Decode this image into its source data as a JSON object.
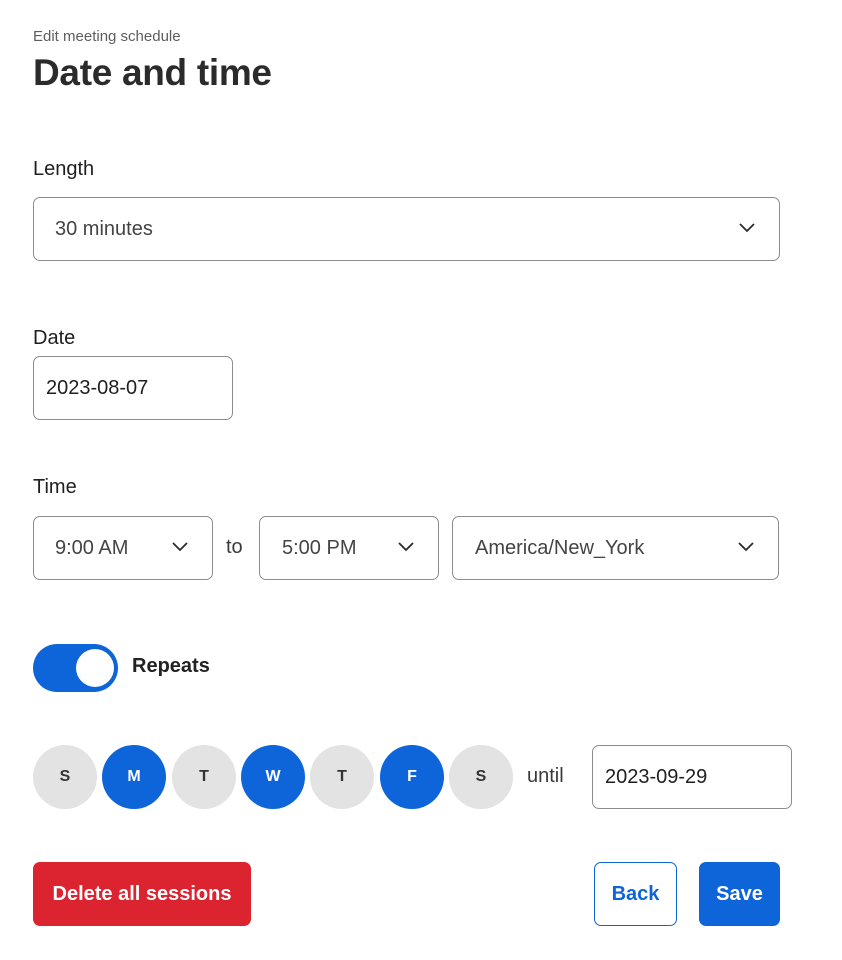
{
  "header": {
    "eyebrow": "Edit meeting schedule",
    "title": "Date and time"
  },
  "length": {
    "label": "Length",
    "value": "30 minutes"
  },
  "date": {
    "label": "Date",
    "value": "2023-08-07"
  },
  "time": {
    "label": "Time",
    "start": "9:00 AM",
    "separator": "to",
    "end": "5:00 PM",
    "timezone": "America/New_York"
  },
  "repeat": {
    "toggle_on": true,
    "label": "Repeats",
    "days": [
      {
        "letter": "S",
        "selected": false
      },
      {
        "letter": "M",
        "selected": true
      },
      {
        "letter": "T",
        "selected": false
      },
      {
        "letter": "W",
        "selected": true
      },
      {
        "letter": "T",
        "selected": false
      },
      {
        "letter": "F",
        "selected": true
      },
      {
        "letter": "S",
        "selected": false
      }
    ],
    "until_label": "until",
    "until_date": "2023-09-29"
  },
  "actions": {
    "delete_label": "Delete all sessions",
    "back_label": "Back",
    "save_label": "Save"
  },
  "colors": {
    "accent": "#0e65d9",
    "danger": "#dc2430",
    "day_off": "#e3e3e3"
  },
  "icons": {
    "dropdown": "chevron-down-icon"
  }
}
